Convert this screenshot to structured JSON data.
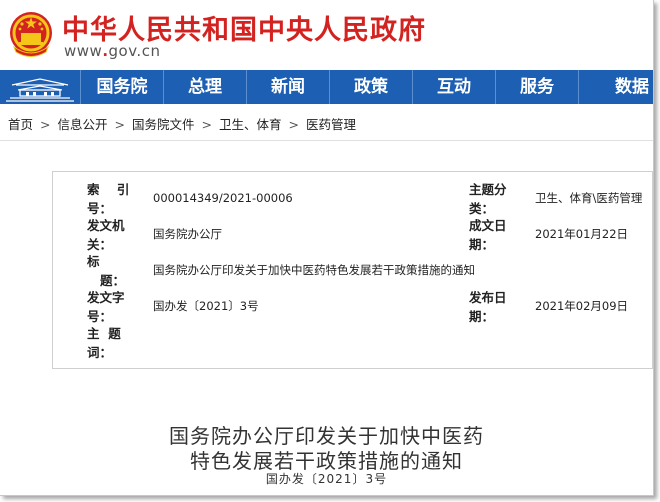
{
  "site": {
    "title": "中华人民共和国中央人民政府",
    "url_prefix": "www",
    "url_dot": ".",
    "url_rest": "gov.cn",
    "brand_red": "#d22320",
    "nav_blue": "#1c5fb3"
  },
  "nav": {
    "items": [
      "国务院",
      "总理",
      "新闻",
      "政策",
      "互动",
      "服务",
      "数据"
    ]
  },
  "breadcrumb": [
    "首页",
    "信息公开",
    "国务院文件",
    "卫生、体育",
    "医药管理"
  ],
  "info": {
    "index_label_1": "索    引",
    "index_label_2": "号：",
    "index_value": "000014349/2021-00006",
    "topic_label_1": "主题分",
    "topic_label_2": "类：",
    "topic_value": "卫生、体育\\医药管理",
    "issuer_label_1": "发文机",
    "issuer_label_2": "关：",
    "issuer_value": "国务院办公厅",
    "created_label_1": "成文日",
    "created_label_2": "期：",
    "created_value": "2021年01月22日",
    "title_label_1": "标",
    "title_label_2": "题：",
    "title_value": "国务院办公厅印发关于加快中医药特色发展若干政策措施的通知",
    "docno_label_1": "发文字",
    "docno_label_2": "号：",
    "docno_value": "国办发〔2021〕3号",
    "published_label_1": "发布日",
    "published_label_2": "期：",
    "published_value": "2021年02月09日",
    "keywords_label_1": "主  题",
    "keywords_label_2": "词："
  },
  "document": {
    "title_line_1": "国务院办公厅印发关于加快中医药",
    "title_line_2": "特色发展若干政策措施的通知",
    "number": "国办发〔2021〕3号"
  }
}
